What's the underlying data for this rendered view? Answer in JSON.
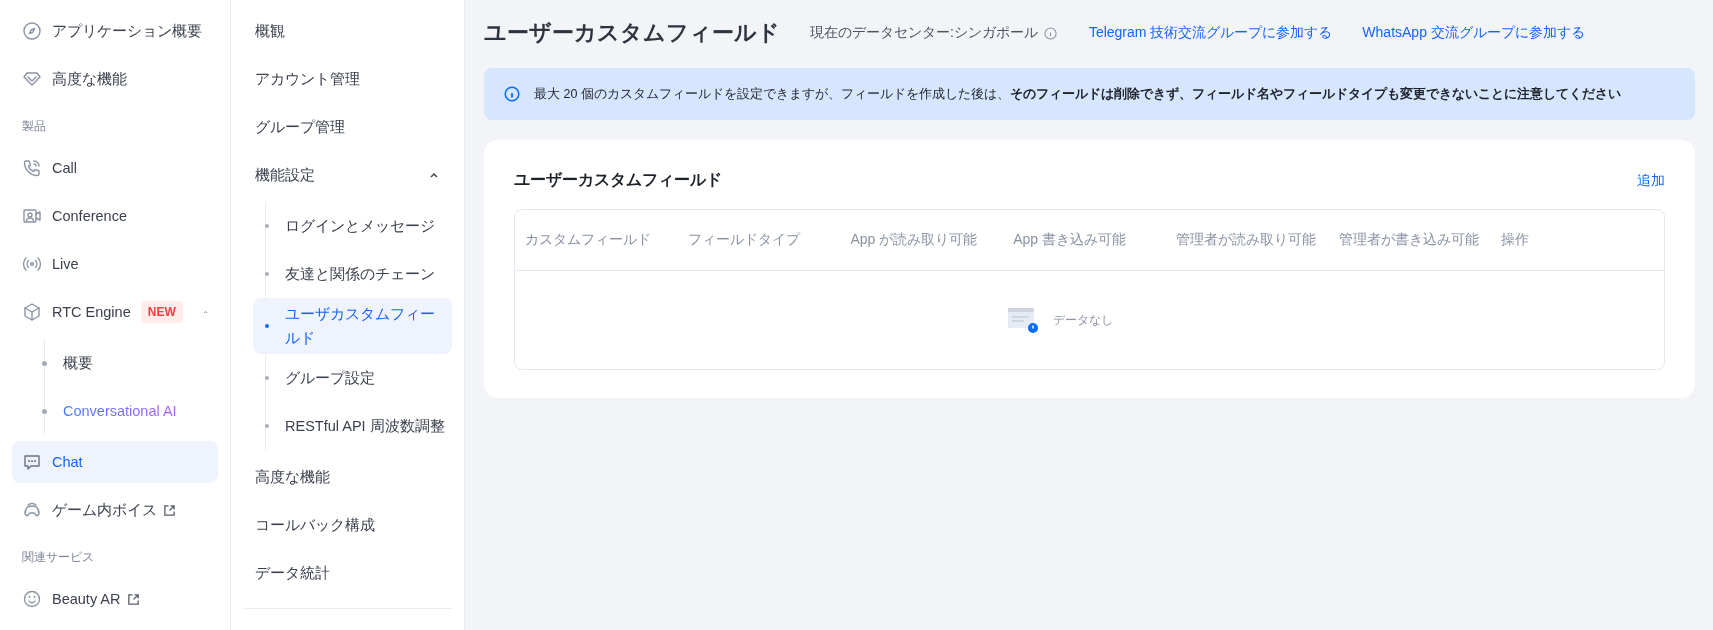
{
  "nav": {
    "items": [
      {
        "kind": "item",
        "label": "アプリケーション概要",
        "selected": false
      },
      {
        "kind": "item",
        "label": "高度な機能",
        "selected": false
      },
      {
        "kind": "section",
        "label": "製品"
      },
      {
        "kind": "item",
        "label": "Call",
        "selected": false
      },
      {
        "kind": "item",
        "label": "Conference",
        "selected": false
      },
      {
        "kind": "item",
        "label": "Live",
        "selected": false
      },
      {
        "kind": "item",
        "label": "RTC Engine",
        "badge": "NEW",
        "expanded": true,
        "selected": false,
        "children": [
          {
            "label": "概要",
            "featured": false
          },
          {
            "label": "Conversational AI",
            "featured": true
          }
        ]
      },
      {
        "kind": "item",
        "label": "Chat",
        "selected": true
      },
      {
        "kind": "item",
        "label": "ゲーム内ボイス",
        "external": true,
        "selected": false
      },
      {
        "kind": "section",
        "label": "関連サービス"
      },
      {
        "kind": "item",
        "label": "Beauty AR",
        "external": true,
        "selected": false
      }
    ]
  },
  "subnav": {
    "items": [
      {
        "label": "概観"
      },
      {
        "label": "アカウント管理"
      },
      {
        "label": "グループ管理"
      },
      {
        "label": "機能設定",
        "expanded": true,
        "children": [
          {
            "label": "ログインとメッセージ",
            "selected": false
          },
          {
            "label": "友達と関係のチェーン",
            "selected": false
          },
          {
            "label": "ユーザカスタムフィールド",
            "selected": true
          },
          {
            "label": "グループ設定",
            "selected": false
          },
          {
            "label": "RESTful API 周波数調整",
            "selected": false
          }
        ]
      },
      {
        "label": "高度な機能"
      },
      {
        "label": "コールバック構成"
      },
      {
        "label": "データ統計"
      }
    ]
  },
  "header": {
    "title": "ユーザーカスタムフィールド",
    "datacenter": "現在のデータセンター:シンガポール",
    "links": [
      "Telegram 技術交流グループに参加する",
      "WhatsApp 交流グループに参加する"
    ]
  },
  "notice": "最大 20 個のカスタムフィールドを設定できますが、フィールドを作成した後は、**そのフィールドは削除できず、フィールド名やフィールドタイプも変更できないことに注意してください**",
  "card": {
    "title": "ユーザーカスタムフィールド",
    "add_link": "追加",
    "table": {
      "columns": [
        "カスタムフィールド",
        "フィールドタイプ",
        "App が読み取り可能",
        "App 書き込み可能",
        "管理者が読み取り可能",
        "管理者が書き込み可能",
        "操作"
      ],
      "empty_text": "データなし"
    }
  }
}
